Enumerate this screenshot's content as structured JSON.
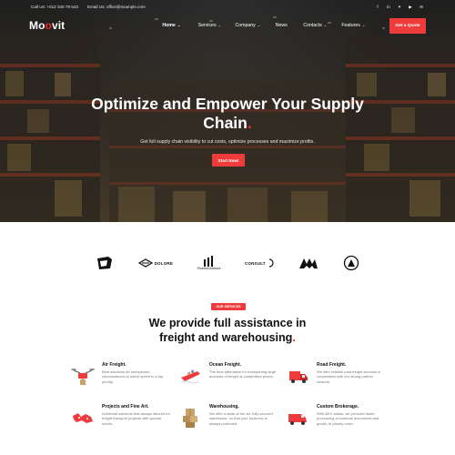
{
  "topbar": {
    "phone": "Call Us: +012 345 78 543",
    "email": "Email Us: office@example.com",
    "social": [
      "f",
      "in",
      "✦",
      "▶",
      "✉"
    ]
  },
  "nav": {
    "logo_main": "Mo",
    "logo_dot": "o",
    "logo_end": "vit",
    "items": [
      {
        "label": "Home",
        "chevron": "⌄"
      },
      {
        "label": "Services",
        "chevron": "⌄"
      },
      {
        "label": "Company",
        "chevron": "⌄"
      },
      {
        "label": "News",
        "chevron": ""
      },
      {
        "label": "Contacts",
        "chevron": "⌄"
      },
      {
        "label": "Features",
        "chevron": "⌄"
      }
    ],
    "cta": "Get a Quote"
  },
  "hero": {
    "title_line1": "Optimize and Empower Your Supply",
    "title_line2": "Chain",
    "title_dot": ".",
    "subtitle": "Get full supply chain visibility to cut costs, optimize processes and maximize profits.",
    "button": "Start Now!"
  },
  "partners": [
    {
      "name": "partner-shield-logo",
      "label": ""
    },
    {
      "name": "partner-dolore-logo",
      "label": "DOLORE"
    },
    {
      "name": "partner-financial-logo",
      "label": "Financial Advisors"
    },
    {
      "name": "partner-consult-logo",
      "label": "CONSULT"
    },
    {
      "name": "partner-m-logo",
      "label": ""
    },
    {
      "name": "partner-circle-logo",
      "label": ""
    }
  ],
  "services_section": {
    "badge": "OUR SERVICES",
    "title_line1": "We provide full assistance in",
    "title_line2": "freight and warehousing",
    "title_dot": "."
  },
  "services": [
    {
      "title": "Air Freight.",
      "desc": "Best solutions for unexpected circumstances in which speed is a top priority.",
      "icon": "drone-icon"
    },
    {
      "title": "Ocean Freight.",
      "desc": "The best alternative for transporting large amounts of freight at competitive prices.",
      "icon": "ship-icon"
    },
    {
      "title": "Road Freight.",
      "desc": "We offer reliable road freight services in cooperation with our strong partner network.",
      "icon": "truck-icon"
    },
    {
      "title": "Projects and Fine Art.",
      "desc": "Individual solutions that always tailored for freight transport projects with special needs.",
      "icon": "map-icon"
    },
    {
      "title": "Warehousing.",
      "desc": "We offer a state of the art, fully secured warehouse, so that your business is always protected.",
      "icon": "boxes-icon"
    },
    {
      "title": "Custom Brokerage.",
      "desc": "With AEO status, we provides faster processing of customs documents and goods, in priority order.",
      "icon": "van-icon"
    }
  ],
  "colors": {
    "accent": "#ef3b3b"
  }
}
